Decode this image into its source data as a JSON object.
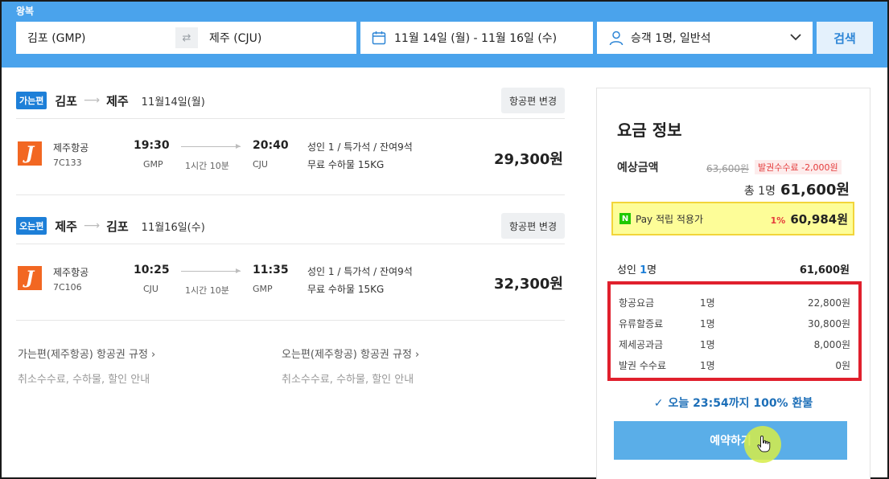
{
  "search": {
    "trip_type": "왕복",
    "from": "김포 (GMP)",
    "to": "제주 (CJU)",
    "swap_icon": "⇄",
    "dates": "11월 14일 (월)  -  11월 16일 (수)",
    "passengers": "승객 1명, 일반석",
    "search_label": "검색"
  },
  "legs": [
    {
      "badge": "가는편",
      "from_city": "김포",
      "arrow": "⟶",
      "to_city": "제주",
      "date": "11월14일(월)",
      "change_label": "항공편 변경",
      "airline": "제주항공",
      "logo_letter": "J",
      "flight_no": "7C133",
      "dep_time": "19:30",
      "dep_code": "GMP",
      "duration": "1시간 10분",
      "arr_time": "20:40",
      "arr_code": "CJU",
      "seat_info": "성인 1 / 특가석 / 잔여9석",
      "bag_info": "무료 수하물 15KG",
      "price": "29,300원"
    },
    {
      "badge": "오는편",
      "from_city": "제주",
      "arrow": "⟶",
      "to_city": "김포",
      "date": "11월16일(수)",
      "change_label": "항공편 변경",
      "airline": "제주항공",
      "logo_letter": "J",
      "flight_no": "7C106",
      "dep_time": "10:25",
      "dep_code": "CJU",
      "duration": "1시간 10분",
      "arr_time": "11:35",
      "arr_code": "GMP",
      "seat_info": "성인 1 / 특가석 / 잔여9석",
      "bag_info": "무료 수하물 15KG",
      "price": "32,300원"
    }
  ],
  "rules": [
    {
      "title": "가는편(제주항공) 항공권 규정  ›",
      "sub": "취소수수료, 수하물, 할인 안내"
    },
    {
      "title": "오는편(제주항공) 항공권 규정  ›",
      "sub": "취소수수료, 수하물, 할인 안내"
    }
  ],
  "fare": {
    "title": "요금 정보",
    "estimate_label": "예상금액",
    "original_price": "63,600원",
    "fee_discount": "발권수수료 -2,000원",
    "total_label": "총 1명",
    "total_price": "61,600원",
    "npay": {
      "icon": "N",
      "label": "Pay 적립 적용가",
      "rate": "1%",
      "price": "60,984원"
    },
    "pax_label_prefix": "성인",
    "pax_count": "1",
    "pax_label_suffix": "명",
    "pax_amount": "61,600원",
    "breakdown": [
      {
        "name": "항공요금",
        "count": "1명",
        "amount": "22,800원"
      },
      {
        "name": "유류할증료",
        "count": "1명",
        "amount": "30,800원"
      },
      {
        "name": "제세공과금",
        "count": "1명",
        "amount": "8,000원"
      },
      {
        "name": "발권 수수료",
        "count": "1명",
        "amount": "0원"
      }
    ],
    "refund_check": "✓",
    "refund_text": "오늘 23:54까지 100% 환불",
    "book_label": "예약하기"
  },
  "colors": {
    "header_bg": "#4aa3ec",
    "badge_blue": "#1d7fd8",
    "highlight_red": "#e0202d",
    "npay_yellow": "#fdfd98",
    "airline_orange": "#f26722"
  }
}
